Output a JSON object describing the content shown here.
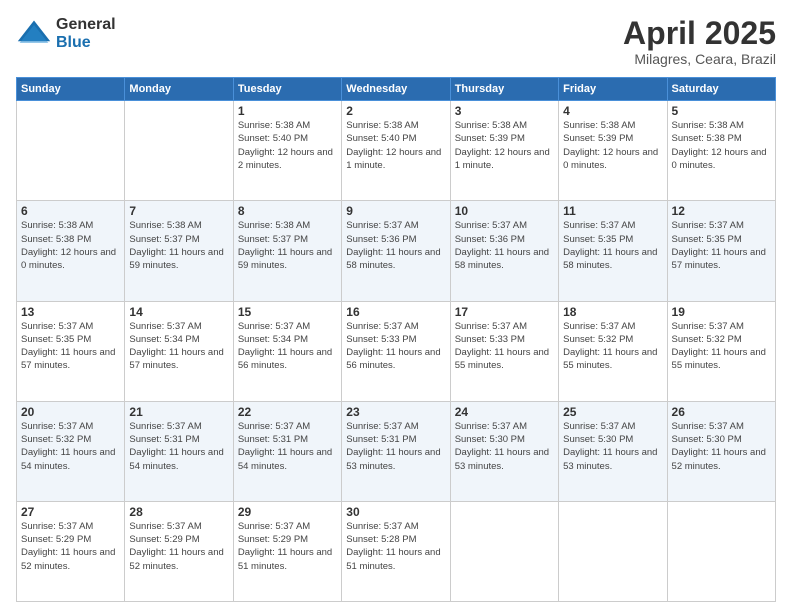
{
  "logo": {
    "general": "General",
    "blue": "Blue"
  },
  "title": "April 2025",
  "subtitle": "Milagres, Ceara, Brazil",
  "days_header": [
    "Sunday",
    "Monday",
    "Tuesday",
    "Wednesday",
    "Thursday",
    "Friday",
    "Saturday"
  ],
  "weeks": [
    [
      {
        "day": "",
        "info": ""
      },
      {
        "day": "",
        "info": ""
      },
      {
        "day": "1",
        "info": "Sunrise: 5:38 AM\nSunset: 5:40 PM\nDaylight: 12 hours and 2 minutes."
      },
      {
        "day": "2",
        "info": "Sunrise: 5:38 AM\nSunset: 5:40 PM\nDaylight: 12 hours and 1 minute."
      },
      {
        "day": "3",
        "info": "Sunrise: 5:38 AM\nSunset: 5:39 PM\nDaylight: 12 hours and 1 minute."
      },
      {
        "day": "4",
        "info": "Sunrise: 5:38 AM\nSunset: 5:39 PM\nDaylight: 12 hours and 0 minutes."
      },
      {
        "day": "5",
        "info": "Sunrise: 5:38 AM\nSunset: 5:38 PM\nDaylight: 12 hours and 0 minutes."
      }
    ],
    [
      {
        "day": "6",
        "info": "Sunrise: 5:38 AM\nSunset: 5:38 PM\nDaylight: 12 hours and 0 minutes."
      },
      {
        "day": "7",
        "info": "Sunrise: 5:38 AM\nSunset: 5:37 PM\nDaylight: 11 hours and 59 minutes."
      },
      {
        "day": "8",
        "info": "Sunrise: 5:38 AM\nSunset: 5:37 PM\nDaylight: 11 hours and 59 minutes."
      },
      {
        "day": "9",
        "info": "Sunrise: 5:37 AM\nSunset: 5:36 PM\nDaylight: 11 hours and 58 minutes."
      },
      {
        "day": "10",
        "info": "Sunrise: 5:37 AM\nSunset: 5:36 PM\nDaylight: 11 hours and 58 minutes."
      },
      {
        "day": "11",
        "info": "Sunrise: 5:37 AM\nSunset: 5:35 PM\nDaylight: 11 hours and 58 minutes."
      },
      {
        "day": "12",
        "info": "Sunrise: 5:37 AM\nSunset: 5:35 PM\nDaylight: 11 hours and 57 minutes."
      }
    ],
    [
      {
        "day": "13",
        "info": "Sunrise: 5:37 AM\nSunset: 5:35 PM\nDaylight: 11 hours and 57 minutes."
      },
      {
        "day": "14",
        "info": "Sunrise: 5:37 AM\nSunset: 5:34 PM\nDaylight: 11 hours and 57 minutes."
      },
      {
        "day": "15",
        "info": "Sunrise: 5:37 AM\nSunset: 5:34 PM\nDaylight: 11 hours and 56 minutes."
      },
      {
        "day": "16",
        "info": "Sunrise: 5:37 AM\nSunset: 5:33 PM\nDaylight: 11 hours and 56 minutes."
      },
      {
        "day": "17",
        "info": "Sunrise: 5:37 AM\nSunset: 5:33 PM\nDaylight: 11 hours and 55 minutes."
      },
      {
        "day": "18",
        "info": "Sunrise: 5:37 AM\nSunset: 5:32 PM\nDaylight: 11 hours and 55 minutes."
      },
      {
        "day": "19",
        "info": "Sunrise: 5:37 AM\nSunset: 5:32 PM\nDaylight: 11 hours and 55 minutes."
      }
    ],
    [
      {
        "day": "20",
        "info": "Sunrise: 5:37 AM\nSunset: 5:32 PM\nDaylight: 11 hours and 54 minutes."
      },
      {
        "day": "21",
        "info": "Sunrise: 5:37 AM\nSunset: 5:31 PM\nDaylight: 11 hours and 54 minutes."
      },
      {
        "day": "22",
        "info": "Sunrise: 5:37 AM\nSunset: 5:31 PM\nDaylight: 11 hours and 54 minutes."
      },
      {
        "day": "23",
        "info": "Sunrise: 5:37 AM\nSunset: 5:31 PM\nDaylight: 11 hours and 53 minutes."
      },
      {
        "day": "24",
        "info": "Sunrise: 5:37 AM\nSunset: 5:30 PM\nDaylight: 11 hours and 53 minutes."
      },
      {
        "day": "25",
        "info": "Sunrise: 5:37 AM\nSunset: 5:30 PM\nDaylight: 11 hours and 53 minutes."
      },
      {
        "day": "26",
        "info": "Sunrise: 5:37 AM\nSunset: 5:30 PM\nDaylight: 11 hours and 52 minutes."
      }
    ],
    [
      {
        "day": "27",
        "info": "Sunrise: 5:37 AM\nSunset: 5:29 PM\nDaylight: 11 hours and 52 minutes."
      },
      {
        "day": "28",
        "info": "Sunrise: 5:37 AM\nSunset: 5:29 PM\nDaylight: 11 hours and 52 minutes."
      },
      {
        "day": "29",
        "info": "Sunrise: 5:37 AM\nSunset: 5:29 PM\nDaylight: 11 hours and 51 minutes."
      },
      {
        "day": "30",
        "info": "Sunrise: 5:37 AM\nSunset: 5:28 PM\nDaylight: 11 hours and 51 minutes."
      },
      {
        "day": "",
        "info": ""
      },
      {
        "day": "",
        "info": ""
      },
      {
        "day": "",
        "info": ""
      }
    ]
  ]
}
